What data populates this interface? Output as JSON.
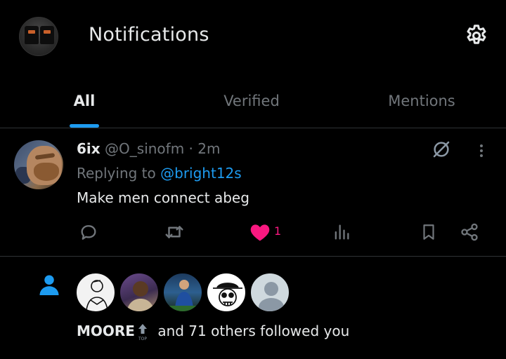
{
  "header": {
    "title": "Notifications",
    "settings_icon": "gear-icon"
  },
  "tabs": [
    {
      "label": "All",
      "active": true
    },
    {
      "label": "Verified",
      "active": false
    },
    {
      "label": "Mentions",
      "active": false
    }
  ],
  "tweet": {
    "name": "6ix",
    "handle": "@O_sinofm",
    "separator": " · ",
    "time": "2m",
    "replying_prefix": "Replying to ",
    "replying_to": "@bright12s",
    "text": "Make men connect abeg",
    "like_count": "1",
    "liked": true
  },
  "follow": {
    "name": "MOORE",
    "badge_text": "TOP",
    "rest": " and 71 others followed you"
  },
  "colors": {
    "accent": "#1d9bf0",
    "like": "#f91880",
    "muted": "#71767b",
    "text": "#e7e9ea"
  }
}
